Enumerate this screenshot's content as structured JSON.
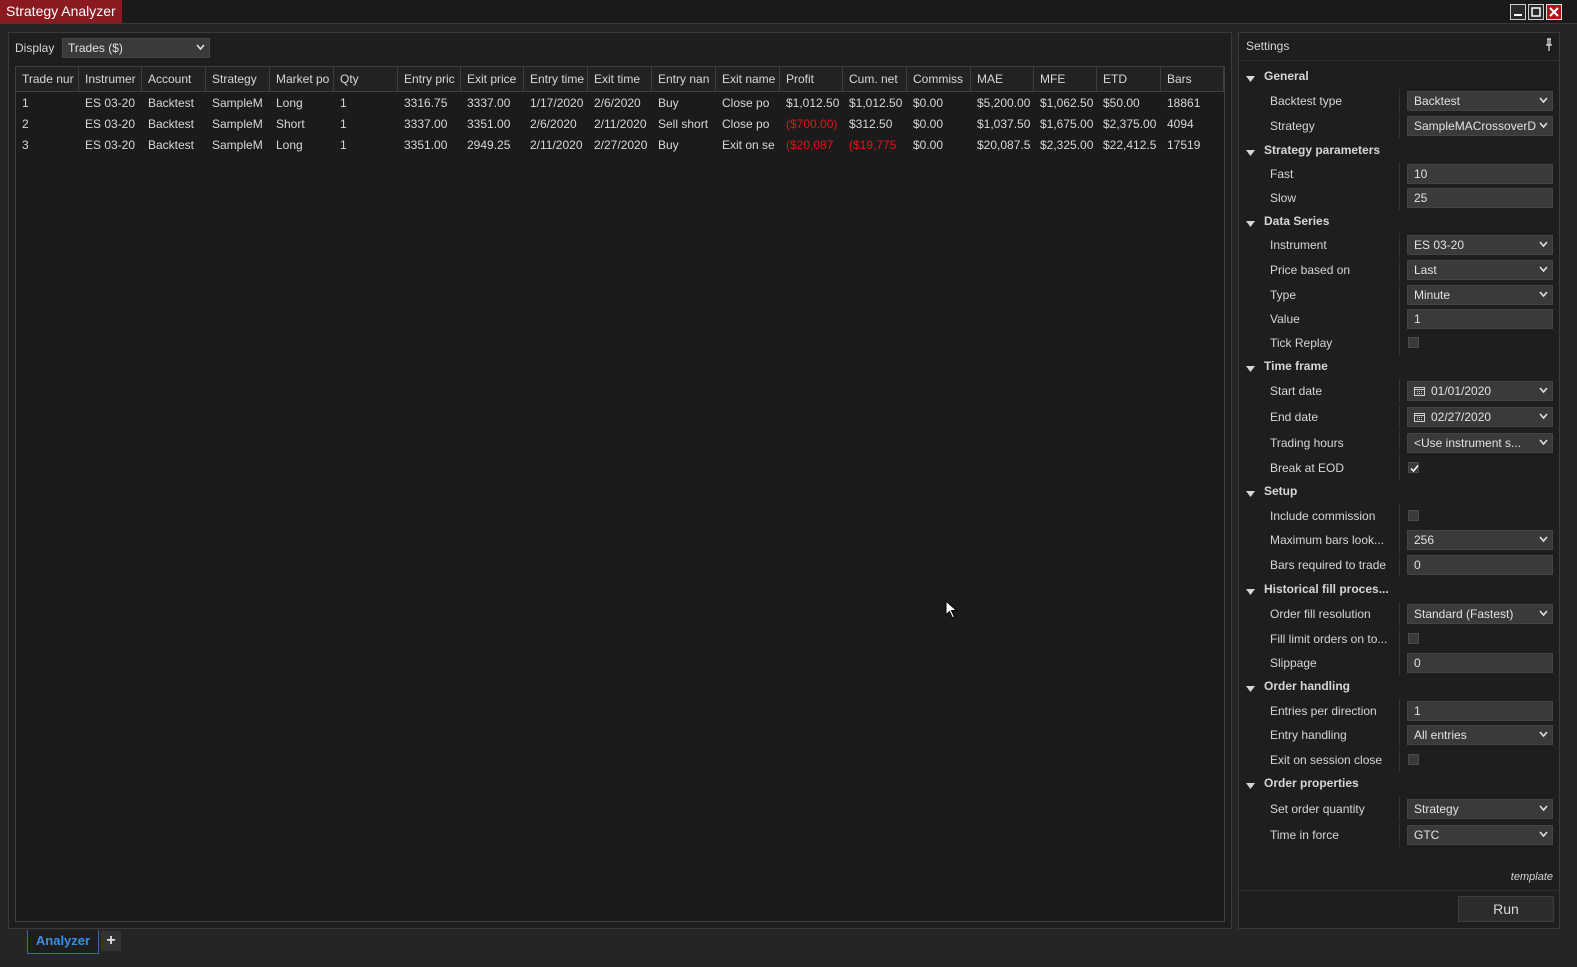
{
  "window": {
    "title": "Strategy Analyzer",
    "minimize_glyph": "▬",
    "maximize_glyph": "▭",
    "close_glyph": "✕"
  },
  "display": {
    "label": "Display",
    "value": "Trades ($)"
  },
  "grid": {
    "columns": [
      "Trade nur",
      "Instrumer",
      "Account",
      "Strategy",
      "Market po",
      "Qty",
      "Entry pric",
      "Exit price",
      "Entry time",
      "Exit time",
      "Entry nan",
      "Exit name",
      "Profit",
      "Cum. net",
      "Commiss",
      "MAE",
      "MFE",
      "ETD",
      "Bars"
    ],
    "rows": [
      [
        "1",
        "ES 03-20",
        "Backtest",
        "SampleM",
        "Long",
        "1",
        "3316.75",
        "3337.00",
        "1/17/2020",
        "2/6/2020",
        "Buy",
        "Close po",
        "$1,012.50",
        "$1,012.50",
        "$0.00",
        "$5,200.00",
        "$1,062.50",
        "$50.00",
        "18861"
      ],
      [
        "2",
        "ES 03-20",
        "Backtest",
        "SampleM",
        "Short",
        "1",
        "3337.00",
        "3351.00",
        "2/6/2020",
        "2/11/2020",
        "Sell short",
        "Close po",
        "($700.00)",
        "$312.50",
        "$0.00",
        "$1,037.50",
        "$1,675.00",
        "$2,375.00",
        "4094"
      ],
      [
        "3",
        "ES 03-20",
        "Backtest",
        "SampleM",
        "Long",
        "1",
        "3351.00",
        "2949.25",
        "2/11/2020",
        "2/27/2020",
        "Buy",
        "Exit on se",
        "($20,087",
        "($19,775",
        "$0.00",
        "$20,087.5",
        "$2,325.00",
        "$22,412.5",
        "17519"
      ]
    ],
    "negative_color": "#e0141a"
  },
  "tabs": {
    "active": "Analyzer",
    "add_glyph": "+"
  },
  "settings": {
    "title": "Settings",
    "template_link": "template",
    "run_label": "Run",
    "sections": {
      "general": "General",
      "strategy_parameters": "Strategy parameters",
      "data_series": "Data Series",
      "time_frame": "Time frame",
      "setup": "Setup",
      "historical_fill": "Historical fill proces...",
      "order_handling": "Order handling",
      "order_properties": "Order properties"
    },
    "props": {
      "backtest_type": {
        "label": "Backtest type",
        "value": "Backtest"
      },
      "strategy": {
        "label": "Strategy",
        "value": "SampleMACrossoverD"
      },
      "fast": {
        "label": "Fast",
        "value": "10"
      },
      "slow": {
        "label": "Slow",
        "value": "25"
      },
      "instrument": {
        "label": "Instrument",
        "value": "ES 03-20"
      },
      "price_based_on": {
        "label": "Price based on",
        "value": "Last"
      },
      "type": {
        "label": "Type",
        "value": "Minute"
      },
      "value": {
        "label": "Value",
        "value": "1"
      },
      "tick_replay": {
        "label": "Tick Replay",
        "checked": false
      },
      "start_date": {
        "label": "Start date",
        "value": "01/01/2020"
      },
      "end_date": {
        "label": "End date",
        "value": "02/27/2020"
      },
      "trading_hours": {
        "label": "Trading hours",
        "value": "<Use instrument s..."
      },
      "break_at_eod": {
        "label": "Break at EOD",
        "checked": true
      },
      "include_commission": {
        "label": "Include commission",
        "checked": false
      },
      "max_bars_lookback": {
        "label": "Maximum bars look...",
        "value": "256"
      },
      "bars_required": {
        "label": "Bars required to trade",
        "value": "0"
      },
      "order_fill_resolution": {
        "label": "Order fill resolution",
        "value": "Standard (Fastest)"
      },
      "fill_limit_orders": {
        "label": "Fill limit orders on to...",
        "checked": false
      },
      "slippage": {
        "label": "Slippage",
        "value": "0"
      },
      "entries_per_direction": {
        "label": "Entries per direction",
        "value": "1"
      },
      "entry_handling": {
        "label": "Entry handling",
        "value": "All entries"
      },
      "exit_on_session_close": {
        "label": "Exit on session close",
        "checked": false
      },
      "set_order_quantity": {
        "label": "Set order quantity",
        "value": "Strategy"
      },
      "time_in_force": {
        "label": "Time in force",
        "value": "GTC"
      }
    }
  }
}
